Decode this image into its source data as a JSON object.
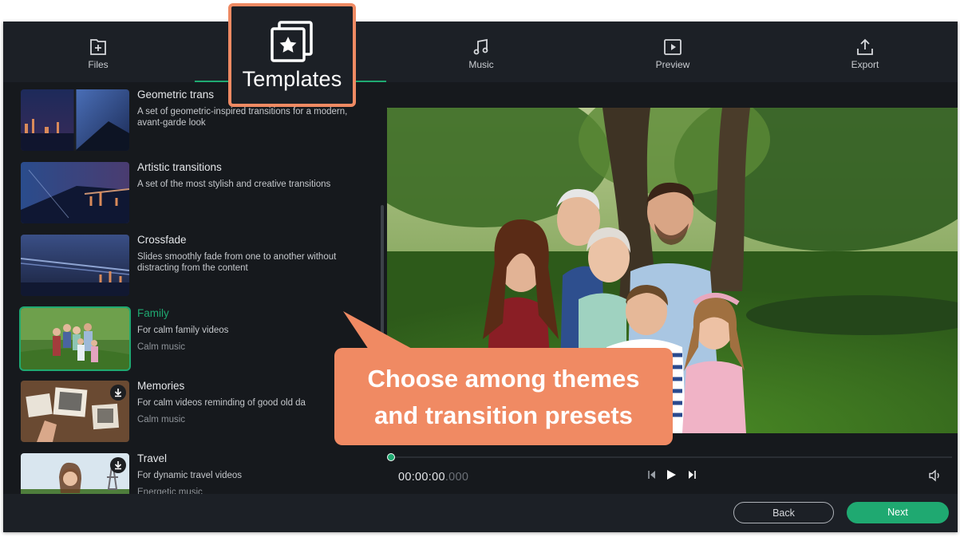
{
  "toolbar": {
    "items": [
      {
        "label": "Files",
        "icon": "files-icon"
      },
      {
        "label": "Templates",
        "icon": "templates-icon"
      },
      {
        "label": "Music",
        "icon": "music-icon"
      },
      {
        "label": "Preview",
        "icon": "preview-icon"
      },
      {
        "label": "Export",
        "icon": "export-icon"
      }
    ],
    "active": "Templates"
  },
  "templates": [
    {
      "title": "Geometric trans",
      "description": "A set of geometric-inspired transitions for a modern, avant-garde look",
      "subtitle": ""
    },
    {
      "title": "Artistic transitions",
      "description": "A set of the most stylish and creative transitions",
      "subtitle": ""
    },
    {
      "title": "Crossfade",
      "description": "Slides smoothly fade from one to another without distracting from the content",
      "subtitle": ""
    },
    {
      "title": "Family",
      "description": "For calm family videos",
      "subtitle": "Calm music",
      "selected": true
    },
    {
      "title": "Memories",
      "description": "For calm videos reminding of good old da",
      "subtitle": "Calm music",
      "download": true
    },
    {
      "title": "Travel",
      "description": "For dynamic travel videos",
      "subtitle": "Energetic music",
      "download": true
    }
  ],
  "player": {
    "timecode_main": "00:00:00",
    "timecode_ms": ".000",
    "progress": 0
  },
  "footer": {
    "back_label": "Back",
    "next_label": "Next"
  },
  "callout": {
    "line1": "Choose among themes",
    "line2": "and transition presets"
  },
  "colors": {
    "accent": "#1fa971",
    "callout": "#f08a63",
    "background": "#16191d"
  }
}
